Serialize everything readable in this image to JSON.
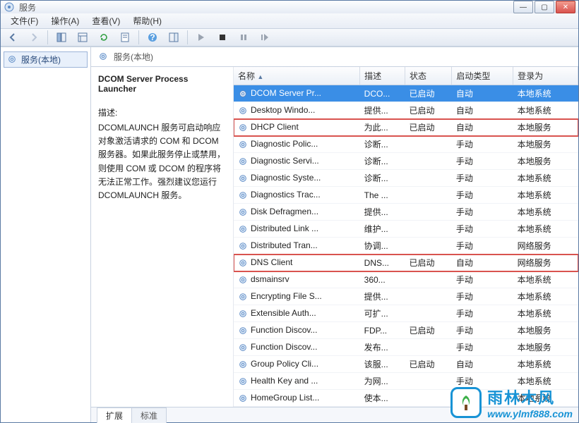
{
  "window": {
    "title": "服务"
  },
  "menubar": {
    "file": "文件(F)",
    "action": "操作(A)",
    "view": "查看(V)",
    "help": "帮助(H)"
  },
  "left": {
    "root": "服务(本地)"
  },
  "right": {
    "title": "服务(本地)",
    "detail": {
      "heading": "DCOM Server Process Launcher",
      "desc_label": "描述:",
      "desc_text": "DCOMLAUNCH 服务可启动响应对象激活请求的 COM 和 DCOM 服务器。如果此服务停止或禁用，则使用 COM 或 DCOM 的程序将无法正常工作。强烈建议您运行 DCOMLAUNCH 服务。"
    },
    "tabs": {
      "ext": "扩展",
      "std": "标准"
    },
    "columns": {
      "name": "名称",
      "desc": "描述",
      "status": "状态",
      "startup": "启动类型",
      "logon": "登录为"
    },
    "rows": [
      {
        "name": "DCOM Server Pr...",
        "desc": "DCO...",
        "status": "已启动",
        "startup": "自动",
        "logon": "本地系统",
        "selected": true
      },
      {
        "name": "Desktop Windo...",
        "desc": "提供...",
        "status": "已启动",
        "startup": "自动",
        "logon": "本地系统"
      },
      {
        "name": "DHCP Client",
        "desc": "为此...",
        "status": "已启动",
        "startup": "自动",
        "logon": "本地服务",
        "highlight": true
      },
      {
        "name": "Diagnostic Polic...",
        "desc": "诊断...",
        "status": "",
        "startup": "手动",
        "logon": "本地服务"
      },
      {
        "name": "Diagnostic Servi...",
        "desc": "诊断...",
        "status": "",
        "startup": "手动",
        "logon": "本地服务"
      },
      {
        "name": "Diagnostic Syste...",
        "desc": "诊断...",
        "status": "",
        "startup": "手动",
        "logon": "本地系统"
      },
      {
        "name": "Diagnostics Trac...",
        "desc": "The ...",
        "status": "",
        "startup": "手动",
        "logon": "本地系统"
      },
      {
        "name": "Disk Defragmen...",
        "desc": "提供...",
        "status": "",
        "startup": "手动",
        "logon": "本地系统"
      },
      {
        "name": "Distributed Link ...",
        "desc": "维护...",
        "status": "",
        "startup": "手动",
        "logon": "本地系统"
      },
      {
        "name": "Distributed Tran...",
        "desc": "协调...",
        "status": "",
        "startup": "手动",
        "logon": "网络服务"
      },
      {
        "name": "DNS Client",
        "desc": "DNS...",
        "status": "已启动",
        "startup": "自动",
        "logon": "网络服务",
        "highlight": true
      },
      {
        "name": "dsmainsrv",
        "desc": "360...",
        "status": "",
        "startup": "手动",
        "logon": "本地系统"
      },
      {
        "name": "Encrypting File S...",
        "desc": "提供...",
        "status": "",
        "startup": "手动",
        "logon": "本地系统"
      },
      {
        "name": "Extensible Auth...",
        "desc": "可扩...",
        "status": "",
        "startup": "手动",
        "logon": "本地系统"
      },
      {
        "name": "Function Discov...",
        "desc": "FDP...",
        "status": "已启动",
        "startup": "手动",
        "logon": "本地服务"
      },
      {
        "name": "Function Discov...",
        "desc": "发布...",
        "status": "",
        "startup": "手动",
        "logon": "本地服务"
      },
      {
        "name": "Group Policy Cli...",
        "desc": "该服...",
        "status": "已启动",
        "startup": "自动",
        "logon": "本地系统"
      },
      {
        "name": "Health Key and ...",
        "desc": "为网...",
        "status": "",
        "startup": "手动",
        "logon": "本地系统"
      },
      {
        "name": "HomeGroup List...",
        "desc": "使本...",
        "status": "",
        "startup": "手动",
        "logon": "本地系统"
      }
    ]
  },
  "watermark": {
    "brand": "雨林木风",
    "url": "www.ylmf888.com"
  }
}
